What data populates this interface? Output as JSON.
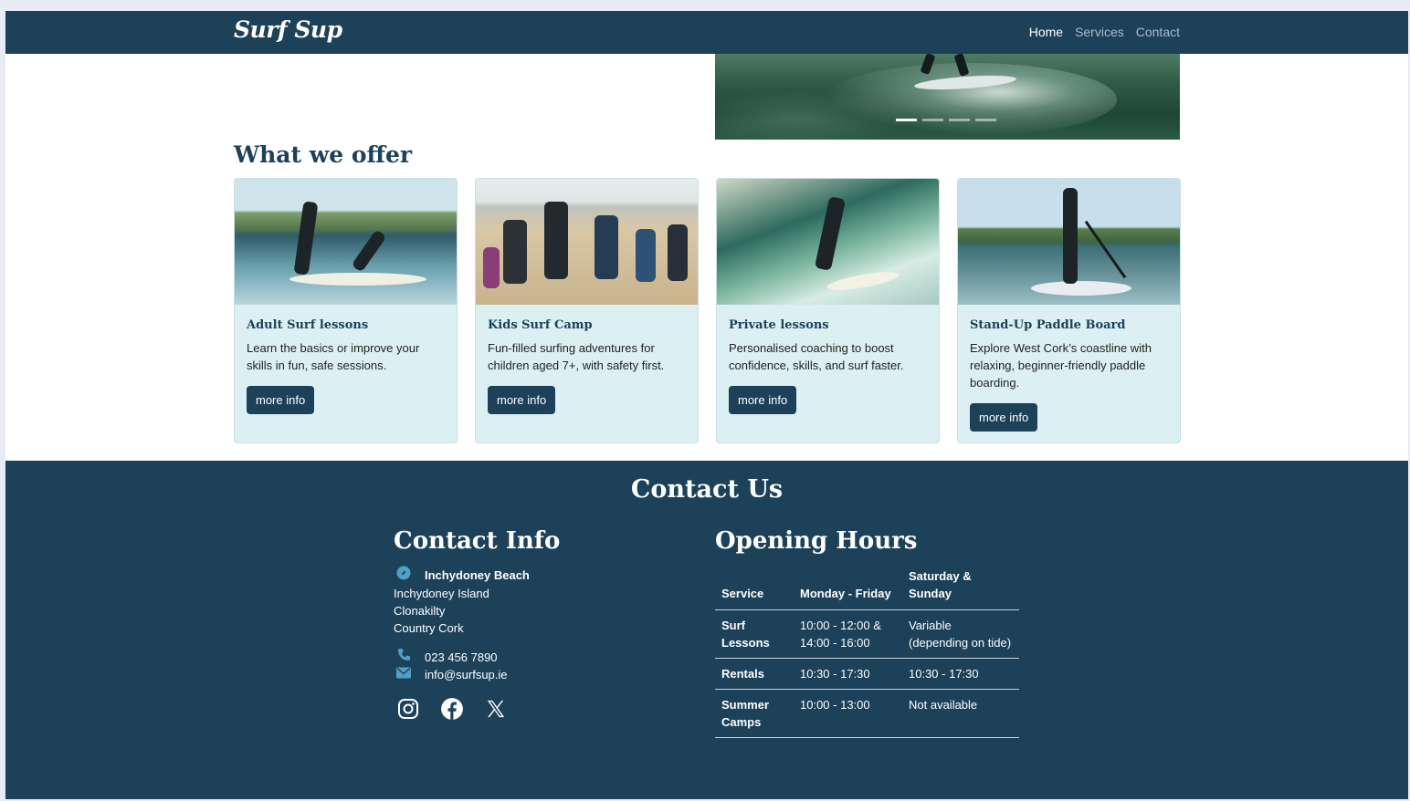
{
  "brand": {
    "logo_text": "Surf Sup"
  },
  "nav": {
    "items": [
      "Home",
      "Services",
      "Contact"
    ],
    "active": "Home"
  },
  "hero": {
    "carousel_indicators": 4,
    "active_indicator": 1
  },
  "offer": {
    "heading": "What we offer",
    "cards": [
      {
        "title": "Adult Surf lessons",
        "text": "Learn the basics or improve your skills in fun, safe sessions.",
        "button": "more info"
      },
      {
        "title": "Kids Surf Camp",
        "text": "Fun-filled surfing adventures for children aged 7+, with safety first.",
        "button": "more info"
      },
      {
        "title": "Private lessons",
        "text": "Personalised coaching to boost confidence, skills, and surf faster.",
        "button": "more info"
      },
      {
        "title": "Stand-Up Paddle Board",
        "text": "Explore West Cork’s coastline with relaxing, beginner-friendly paddle boarding.",
        "button": "more info"
      }
    ]
  },
  "contact": {
    "heading": "Contact Us",
    "info_title": "Contact Info",
    "address": {
      "line1": "Inchydoney Beach",
      "line2": "Inchydoney Island",
      "line3": "Clonakilty",
      "line4": "Country Cork"
    },
    "phone": "023 456 7890",
    "email": "info@surfsup.ie",
    "social_icons": [
      "instagram-icon",
      "facebook-icon",
      "x-icon"
    ],
    "hours_title": "Opening Hours",
    "table": {
      "headers": [
        "Service",
        "Monday - Friday",
        "Saturday & Sunday"
      ],
      "rows": [
        [
          "Surf Lessons",
          "10:00 - 12:00 & 14:00 - 16:00",
          "Variable (depending on tide)"
        ],
        [
          "Rentals",
          "10:30 - 17:30",
          "10:30 - 17:30"
        ],
        [
          "Summer Camps",
          "10:00 - 13:00",
          "Not available"
        ]
      ]
    }
  },
  "colors": {
    "primary": "#1c4159",
    "card_bg": "#dcf0f3",
    "icon_accent": "#4f9fc6"
  }
}
